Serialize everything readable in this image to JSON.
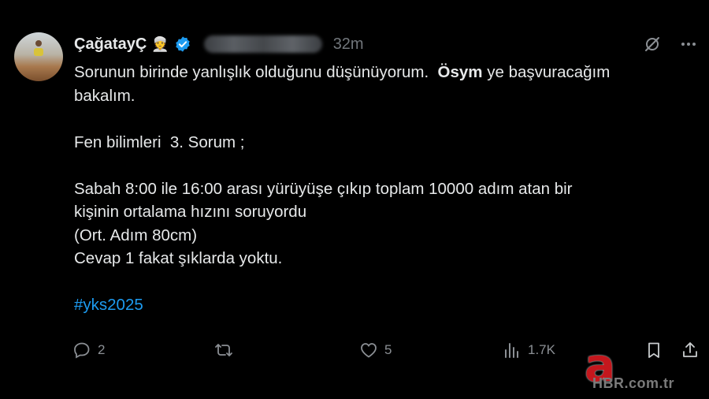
{
  "tweet": {
    "author_name": "ÇağatayÇ",
    "author_emoji": "👳",
    "time": "32m",
    "text_line1_a": "Sorunun birinde yanlışlık olduğunu düşünüyorum.  ",
    "text_line1_bold": "Ösym",
    "text_line1_b": " ye başvuracağım",
    "text_line2": "bakalım.",
    "text_line3": "Fen bilimleri  3. Sorum ;",
    "text_line4": "Sabah 8:00 ile 16:00 arası yürüyüşe çıkıp toplam 10000 adım atan bir",
    "text_line5": "kişinin ortalama hızını soruyordu",
    "text_line6": "(Ort. Adım 80cm)",
    "text_line7": "Cevap 1 fakat şıklarda yoktu.",
    "hashtag": "#yks2025"
  },
  "actions": {
    "replies": "2",
    "likes": "5",
    "views": "1.7K"
  },
  "watermark": {
    "letter": "a",
    "text": "HBR.com.tr"
  },
  "colors": {
    "background": "#000000",
    "text": "#e7e9ea",
    "muted": "#71767b",
    "link": "#1d9bf0",
    "verified": "#1d9bf0",
    "watermark_red": "#c4171d"
  },
  "icons": [
    "grok-icon",
    "more-icon",
    "reply-icon",
    "retweet-icon",
    "like-icon",
    "views-icon",
    "bookmark-icon",
    "share-icon",
    "verified-badge-icon"
  ]
}
